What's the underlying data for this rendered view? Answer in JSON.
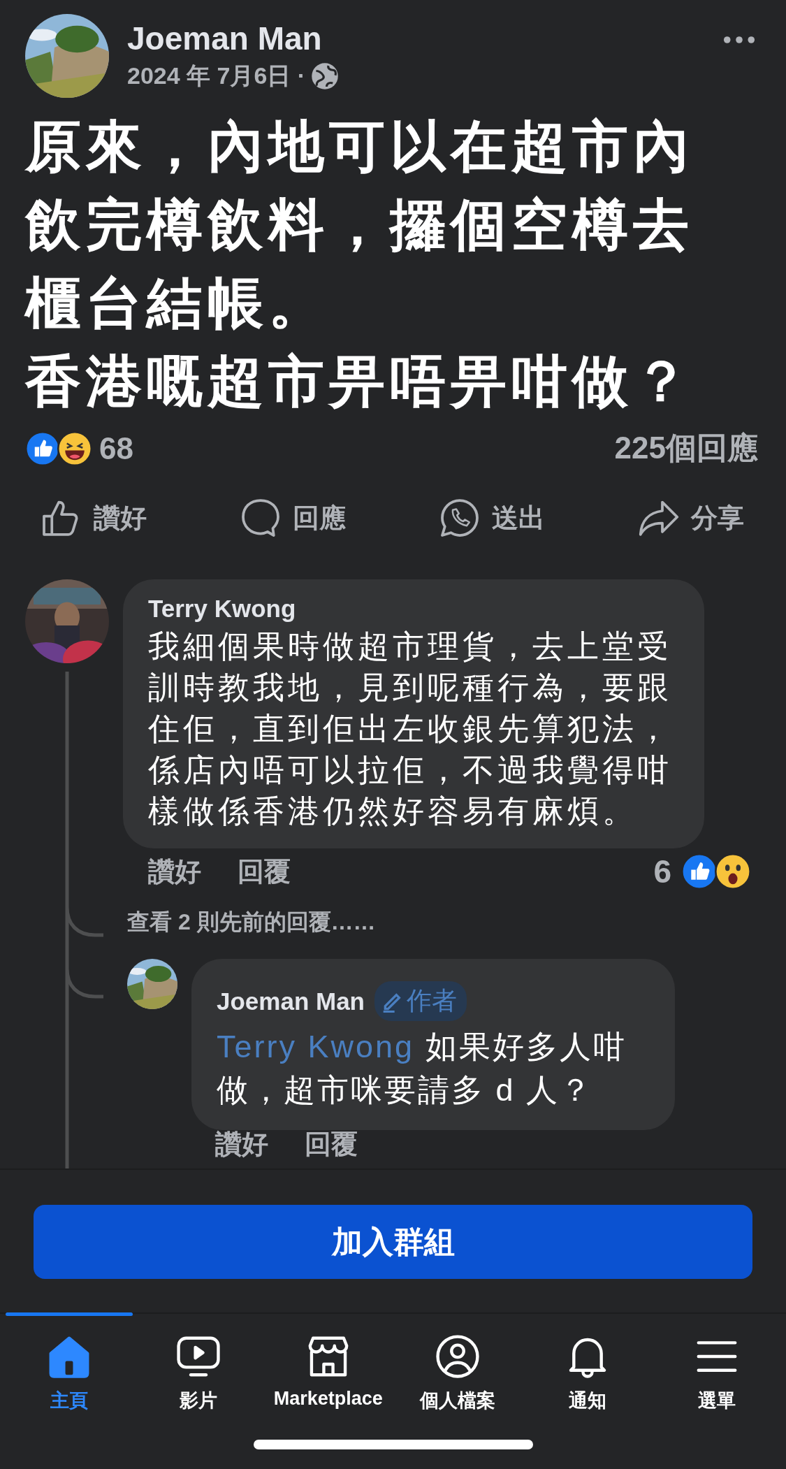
{
  "post": {
    "author": "Joeman Man",
    "date": "2024 年 7月6日 ·",
    "text": [
      "原來，內地可以在超市內飲完樽飲料，攞個空樽去櫃台結帳。",
      "香港嘅超市畀唔畀咁做？"
    ],
    "reactions": [
      {
        "kind": "like"
      },
      {
        "kind": "haha"
      }
    ],
    "reaction_count": "68",
    "comment_count": "225個回應",
    "actions": [
      {
        "kind": "like",
        "label": "讚好"
      },
      {
        "kind": "comment",
        "label": "回應"
      },
      {
        "kind": "send",
        "label": "送出"
      },
      {
        "kind": "share",
        "label": "分享"
      }
    ]
  },
  "comment": {
    "author": "Terry Kwong",
    "text": "我細個果時做超市理貨，去上堂受訓時教我地，見到呢種行為，要跟住佢，直到佢出左收銀先算犯法，係店內唔可以拉佢，不過我覺得咁樣做係香港仍然好容易有麻煩。",
    "actions": [
      "讚好",
      "回覆"
    ],
    "reaction_count": "6",
    "reactions": [
      {
        "kind": "like"
      },
      {
        "kind": "wow"
      }
    ],
    "more_replies": "查看 2 則先前的回覆……"
  },
  "reply": {
    "author": "Joeman Man",
    "badge": "作者",
    "mention": "Terry Kwong",
    "text": " 如果好多人咁做，超市咪要請多 d 人？",
    "actions": [
      "讚好",
      "回覆"
    ]
  },
  "join_button": "加入群組",
  "nav": [
    {
      "kind": "home",
      "label": "主頁",
      "selected": true
    },
    {
      "kind": "video",
      "label": "影片",
      "selected": false
    },
    {
      "kind": "marketplace",
      "label": "Marketplace",
      "selected": false
    },
    {
      "kind": "profile",
      "label": "個人檔案",
      "selected": false
    },
    {
      "kind": "bell",
      "label": "通知",
      "selected": false
    },
    {
      "kind": "menu",
      "label": "選單",
      "selected": false
    }
  ]
}
